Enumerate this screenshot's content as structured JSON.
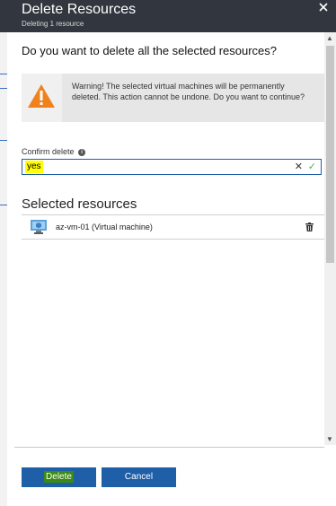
{
  "blade": {
    "title": "Delete Resources",
    "subtitle": "Deleting 1 resource",
    "close_icon": "close-icon"
  },
  "question": "Do you want to delete all the selected resources?",
  "warning": {
    "icon": "warning-triangle-icon",
    "text": "Warning! The selected virtual machines will be permanently deleted. This action cannot be undone. Do you want to continue?"
  },
  "confirm": {
    "label": "Confirm delete",
    "info_icon": "info-icon",
    "value": "yes",
    "clear_glyph": "✕",
    "check_glyph": "✓"
  },
  "selected": {
    "title": "Selected resources",
    "items": [
      {
        "name": "az-vm-01",
        "type": "(Virtual machine)",
        "icon": "virtual-machine-icon",
        "action_icon": "trash-icon"
      }
    ]
  },
  "buttons": {
    "delete": "Delete",
    "cancel": "Cancel"
  },
  "colors": {
    "header": "#32373f",
    "accent": "#1f5fa8",
    "warning": "#f0821e",
    "highlight": "#ffff00"
  }
}
